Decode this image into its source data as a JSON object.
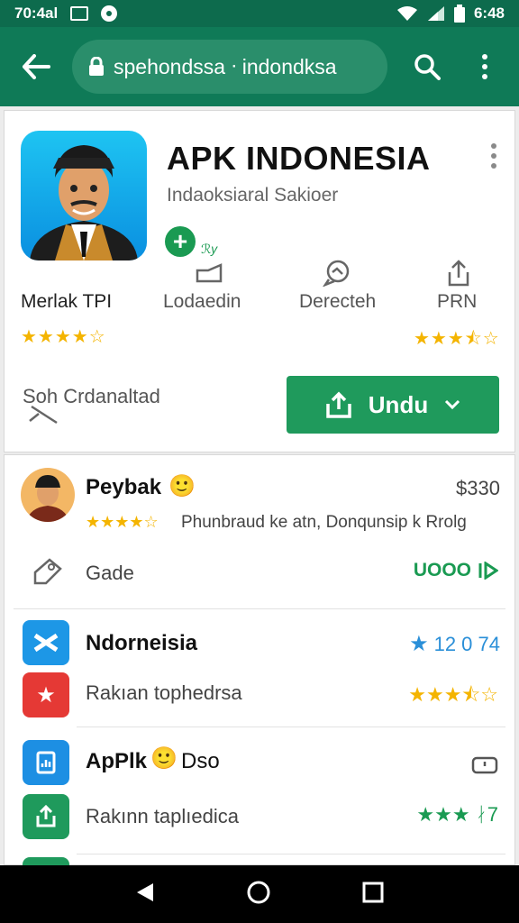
{
  "status_bar": {
    "time_left": "70:4al",
    "time_right": "6:48"
  },
  "toolbar": {
    "url": "spehondssa ᐧ indondksa"
  },
  "app": {
    "title": "APK INDONESIA",
    "subtitle": "Indaoksiaral Sakioer",
    "badge_label": "ℛy",
    "stats": [
      {
        "label": "Merlak TPI",
        "stars": "★★★★☆"
      },
      {
        "label": "Lodaedin",
        "stars": ""
      },
      {
        "label": "Derecteh",
        "stars": ""
      },
      {
        "label": "PRN",
        "stars": "★★★⯪☆"
      }
    ],
    "search_link": "Soh Crdanaltad",
    "install_label": "Undu"
  },
  "list": {
    "item1": {
      "title": "Peybak",
      "emoji": "🙂",
      "price": "$330",
      "stars": "★★★★☆",
      "description": "Phunbraud ke atn, Donqunsip k Rrolg",
      "sub_label": "Gade",
      "action_label": "UOOO"
    },
    "item2": {
      "title": "Ndorneisia",
      "rating": "12  0 74",
      "sub_label": "Rakıan tophedrsa",
      "stars": "★★★⯪☆"
    },
    "item3": {
      "title": "ApPlk",
      "emoji": "🙂",
      "title_suffix": "Dso",
      "sub_label": "Rakınn taplıedica",
      "stars": "★★★",
      "rating_suffix": "ᛅ7"
    }
  },
  "colors": {
    "toolbar": "#0f7a57",
    "accent_green": "#1f9a5c",
    "star": "#f4b400"
  }
}
